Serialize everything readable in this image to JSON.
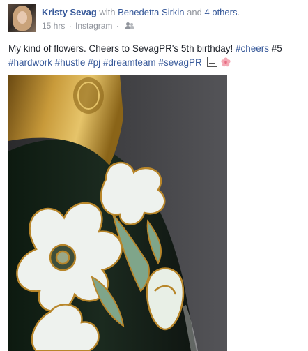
{
  "post": {
    "author": "Kristy Sevag",
    "with_text": "with",
    "tagged_person": "Benedetta Sirkin",
    "and_text": "and",
    "others": "4 others",
    "period": ".",
    "time": "15 hrs",
    "separator": "·",
    "source": "Instagram",
    "audience_icon": "friends-icon",
    "text_plain": "My kind of flowers. Cheers to SevagPR's 5th birthday! ",
    "hashtags_line1": [
      "#cheers",
      "#5"
    ],
    "hashtags_line2": [
      "#hardwork",
      "#hustle",
      "#pj",
      "#dreamteam",
      "#sevagPR"
    ],
    "emoji": [
      "squared-text-emoji",
      "cherry-blossom-emoji"
    ]
  },
  "colors": {
    "link": "#365899",
    "muted": "#90949c",
    "text": "#1d2129"
  }
}
